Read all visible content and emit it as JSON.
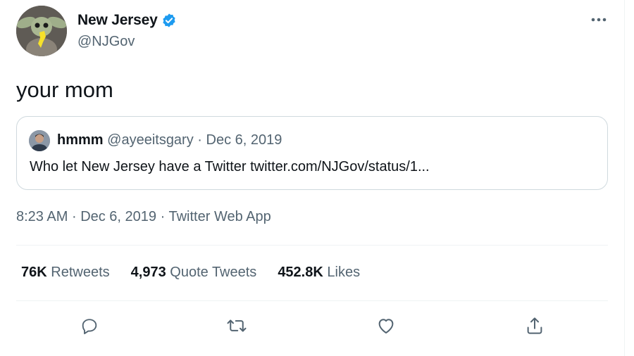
{
  "author": {
    "name": "New Jersey",
    "handle": "@NJGov",
    "verified": true,
    "avatar": "baby-yoda-holding-nj-avatar",
    "verified_color": "#1d9bf0"
  },
  "tweet": {
    "text": "your mom"
  },
  "quote": {
    "name": "hmmm",
    "handle": "@ayeeitsgary",
    "separator": "·",
    "date": "Dec 6, 2019",
    "text": "Who let New Jersey have a Twitter twitter.com/NJGov/status/1..."
  },
  "meta": {
    "time": "8:23 AM",
    "separator": "·",
    "date": "Dec 6, 2019",
    "source": "Twitter Web App"
  },
  "stats": {
    "retweets_count": "76K",
    "retweets_label": "Retweets",
    "quotes_count": "4,973",
    "quotes_label": "Quote Tweets",
    "likes_count": "452.8K",
    "likes_label": "Likes"
  },
  "actions": {
    "reply": "reply-icon",
    "retweet": "retweet-icon",
    "like": "heart-icon",
    "share": "share-icon",
    "more": "more-icon"
  },
  "colors": {
    "text": "#0f1419",
    "secondary": "#536471",
    "border": "#cfd9de",
    "divider": "#eff3f4"
  }
}
